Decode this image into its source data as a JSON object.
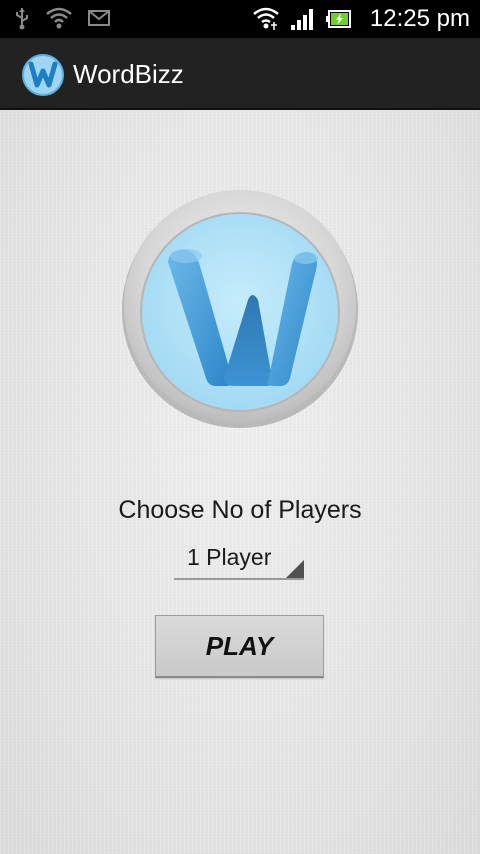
{
  "status_bar": {
    "time": "12:25 pm",
    "left_icons": [
      "usb-icon",
      "wifi-icon",
      "mail-icon"
    ],
    "right_icons": [
      "wifi-hotspot-icon",
      "signal-icon",
      "battery-charging-icon"
    ]
  },
  "action_bar": {
    "title": "WordBizz",
    "icon": "app-logo-icon"
  },
  "main": {
    "choose_label": "Choose No of Players",
    "players_select": {
      "selected": "1 Player"
    },
    "play_label": "PLAY"
  },
  "colors": {
    "status_bar_bg": "#000000",
    "action_bar_bg": "#222222",
    "logo_blue": "#3a8fcf",
    "logo_light_blue": "#aee0f7",
    "button_bg": "#d2d2d2"
  }
}
